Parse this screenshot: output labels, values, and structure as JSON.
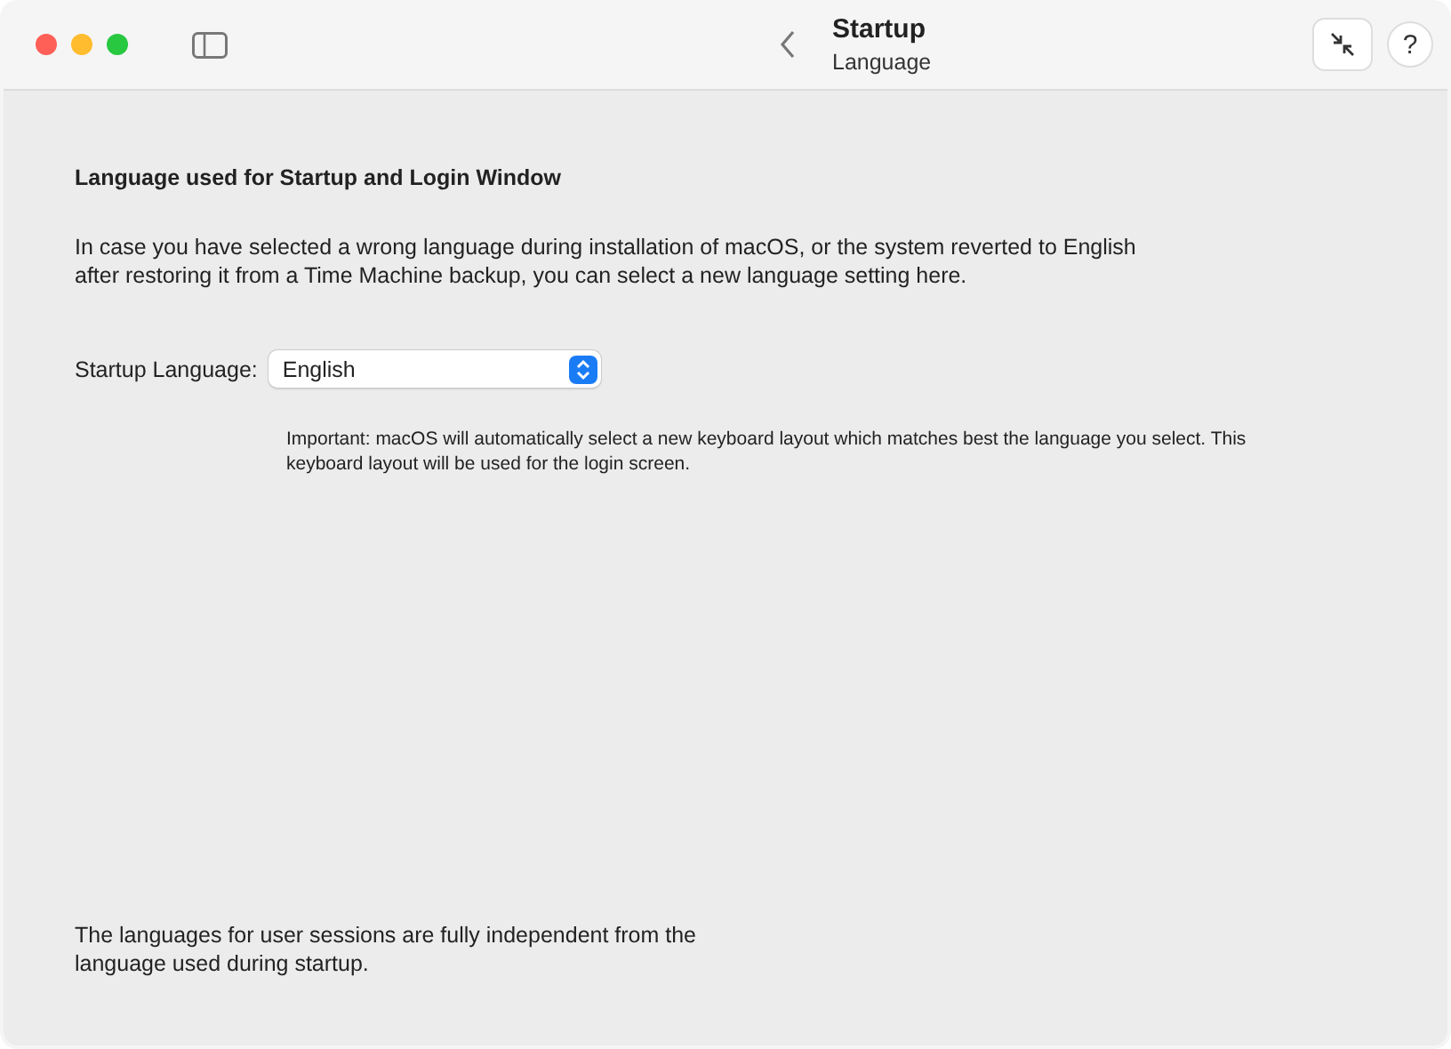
{
  "window": {
    "title": "Startup",
    "subtitle": "Language",
    "help_button": "?"
  },
  "heading": "Language used for Startup and Login Window",
  "intro": [
    "In case you have selected a wrong language during installation of macOS, or the system reverted to English",
    "after restoring it from a Time Machine backup, you can select a new language setting here."
  ],
  "language_field": {
    "label": "Startup Language:",
    "value": "English"
  },
  "note": [
    "Important: macOS will automatically select a new keyboard layout which matches best the language you select. This",
    "keyboard layout will be used for the login screen."
  ],
  "footer": [
    "The languages for user sessions are fully independent from the",
    "language used during startup."
  ]
}
